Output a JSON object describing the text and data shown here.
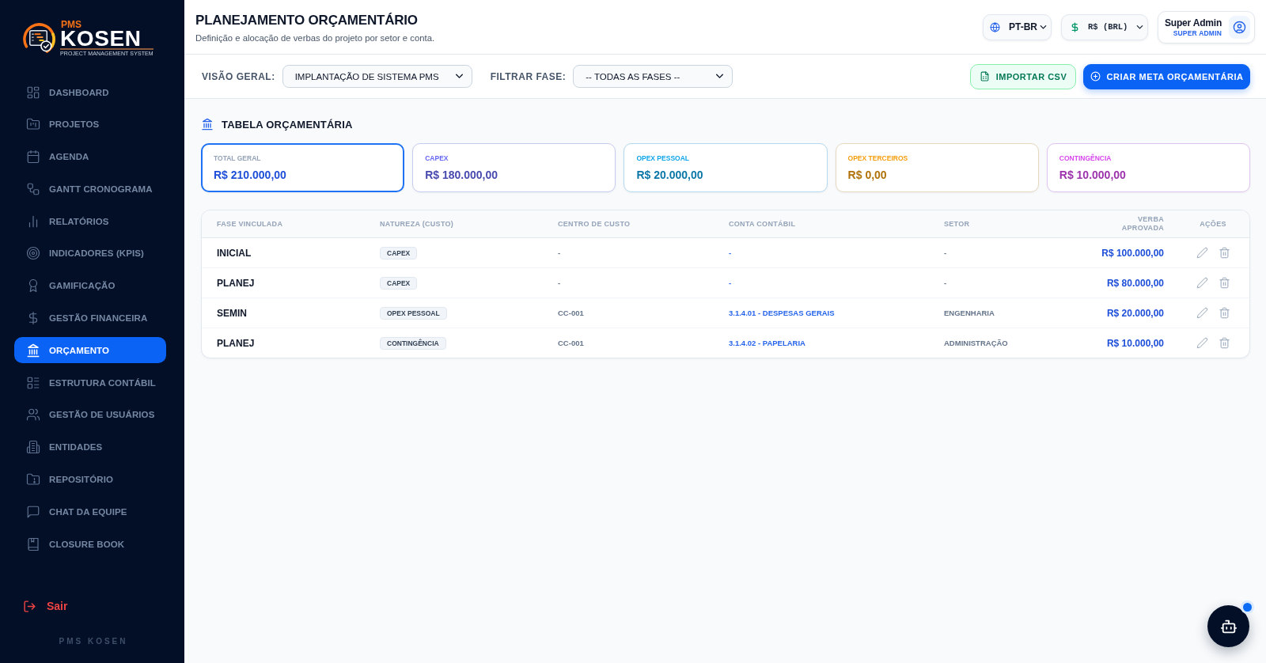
{
  "sidebar": {
    "logo": {
      "tag": "PMS",
      "name": "KOSEN",
      "tagline": "PROJECT MANAGEMENT SYSTEM"
    },
    "items": [
      {
        "label": "DASHBOARD",
        "selected": false
      },
      {
        "label": "PROJETOS",
        "selected": false
      },
      {
        "label": "AGENDA",
        "selected": false
      },
      {
        "label": "GANTT CRONOGRAMA",
        "selected": false
      },
      {
        "label": "RELATÓRIOS",
        "selected": false
      },
      {
        "label": "INDICADORES (KPIS)",
        "selected": false
      },
      {
        "label": "GAMIFICAÇÃO",
        "selected": false
      },
      {
        "label": "GESTÃO FINANCEIRA",
        "selected": false
      },
      {
        "label": "ORÇAMENTO",
        "selected": true
      },
      {
        "label": "ESTRUTURA CONTÁBIL",
        "selected": false
      },
      {
        "label": "GESTÃO DE USUÁRIOS",
        "selected": false
      },
      {
        "label": "ENTIDADES",
        "selected": false
      },
      {
        "label": "REPOSITÓRIO",
        "selected": false
      },
      {
        "label": "CHAT DA EQUIPE",
        "selected": false
      },
      {
        "label": "CLOSURE BOOK",
        "selected": false
      }
    ],
    "logout": "Sair",
    "footer": "PMS KOSEN"
  },
  "header": {
    "title": "PLANEJAMENTO ORÇAMENTÁRIO",
    "subtitle": "Definição e alocação de verbas do projeto por setor e conta.",
    "language": "PT-BR",
    "currency": "R$ (BRL)",
    "user": {
      "name": "Super Admin",
      "role": "SUPER ADMIN"
    }
  },
  "toolbar": {
    "filters": [
      {
        "label": "VISÃO GERAL:",
        "value": "IMPLANTAÇÃO DE SISTEMA PMS"
      },
      {
        "label": "FILTRAR FASE:",
        "value": "-- TODAS AS FASES --"
      }
    ],
    "buttons": [
      {
        "kind": "secondary",
        "label": "IMPORTAR CSV"
      },
      {
        "kind": "primary",
        "label": "CRIAR META ORÇAMENTÁRIA"
      }
    ]
  },
  "section_title": "TABELA ORÇAMENTÁRIA",
  "summary_cards": [
    {
      "label": "TOTAL GERAL",
      "value": "R$ 210.000,00",
      "selected": true,
      "color": "#94a3b8"
    },
    {
      "label": "CAPEX",
      "value": "R$ 180.000,00",
      "selected": false,
      "color": "#6366f1"
    },
    {
      "label": "OPEX PESSOAL",
      "value": "R$ 20.000,00",
      "selected": false,
      "color": "#0ea5e9"
    },
    {
      "label": "OPEX TERCEIROS",
      "value": "R$ 0,00",
      "selected": false,
      "color": "#f59e0b"
    },
    {
      "label": "CONTINGÊNCIA",
      "value": "R$ 10.000,00",
      "selected": false,
      "color": "#d946ef"
    }
  ],
  "table": {
    "columns": [
      "FASE VINCULADA",
      "NATUREZA (CUSTO)",
      "CENTRO DE CUSTO",
      "CONTA CONTÁBIL",
      "SETOR",
      "VERBA APROVADA",
      "AÇÕES"
    ],
    "rows": [
      {
        "phase": "INICIAL",
        "nature": "CAPEX",
        "cost_center": "-",
        "account": "-",
        "sector": "-",
        "amount": "R$ 100.000,00"
      },
      {
        "phase": "PLANEJ",
        "nature": "CAPEX",
        "cost_center": "-",
        "account": "-",
        "sector": "-",
        "amount": "R$ 80.000,00"
      },
      {
        "phase": "SEMIN",
        "nature": "OPEX PESSOAL",
        "cost_center": "CC-001",
        "account": "3.1.4.01 - DESPESAS GERAIS",
        "sector": "ENGENHARIA",
        "amount": "R$ 20.000,00"
      },
      {
        "phase": "PLANEJ",
        "nature": "CONTINGÊNCIA",
        "cost_center": "CC-001",
        "account": "3.1.4.02 - PAPELARIA",
        "sector": "ADMINISTRAÇÃO",
        "amount": "R$ 10.000,00"
      }
    ]
  },
  "assistant_button": {
    "unread": true
  }
}
